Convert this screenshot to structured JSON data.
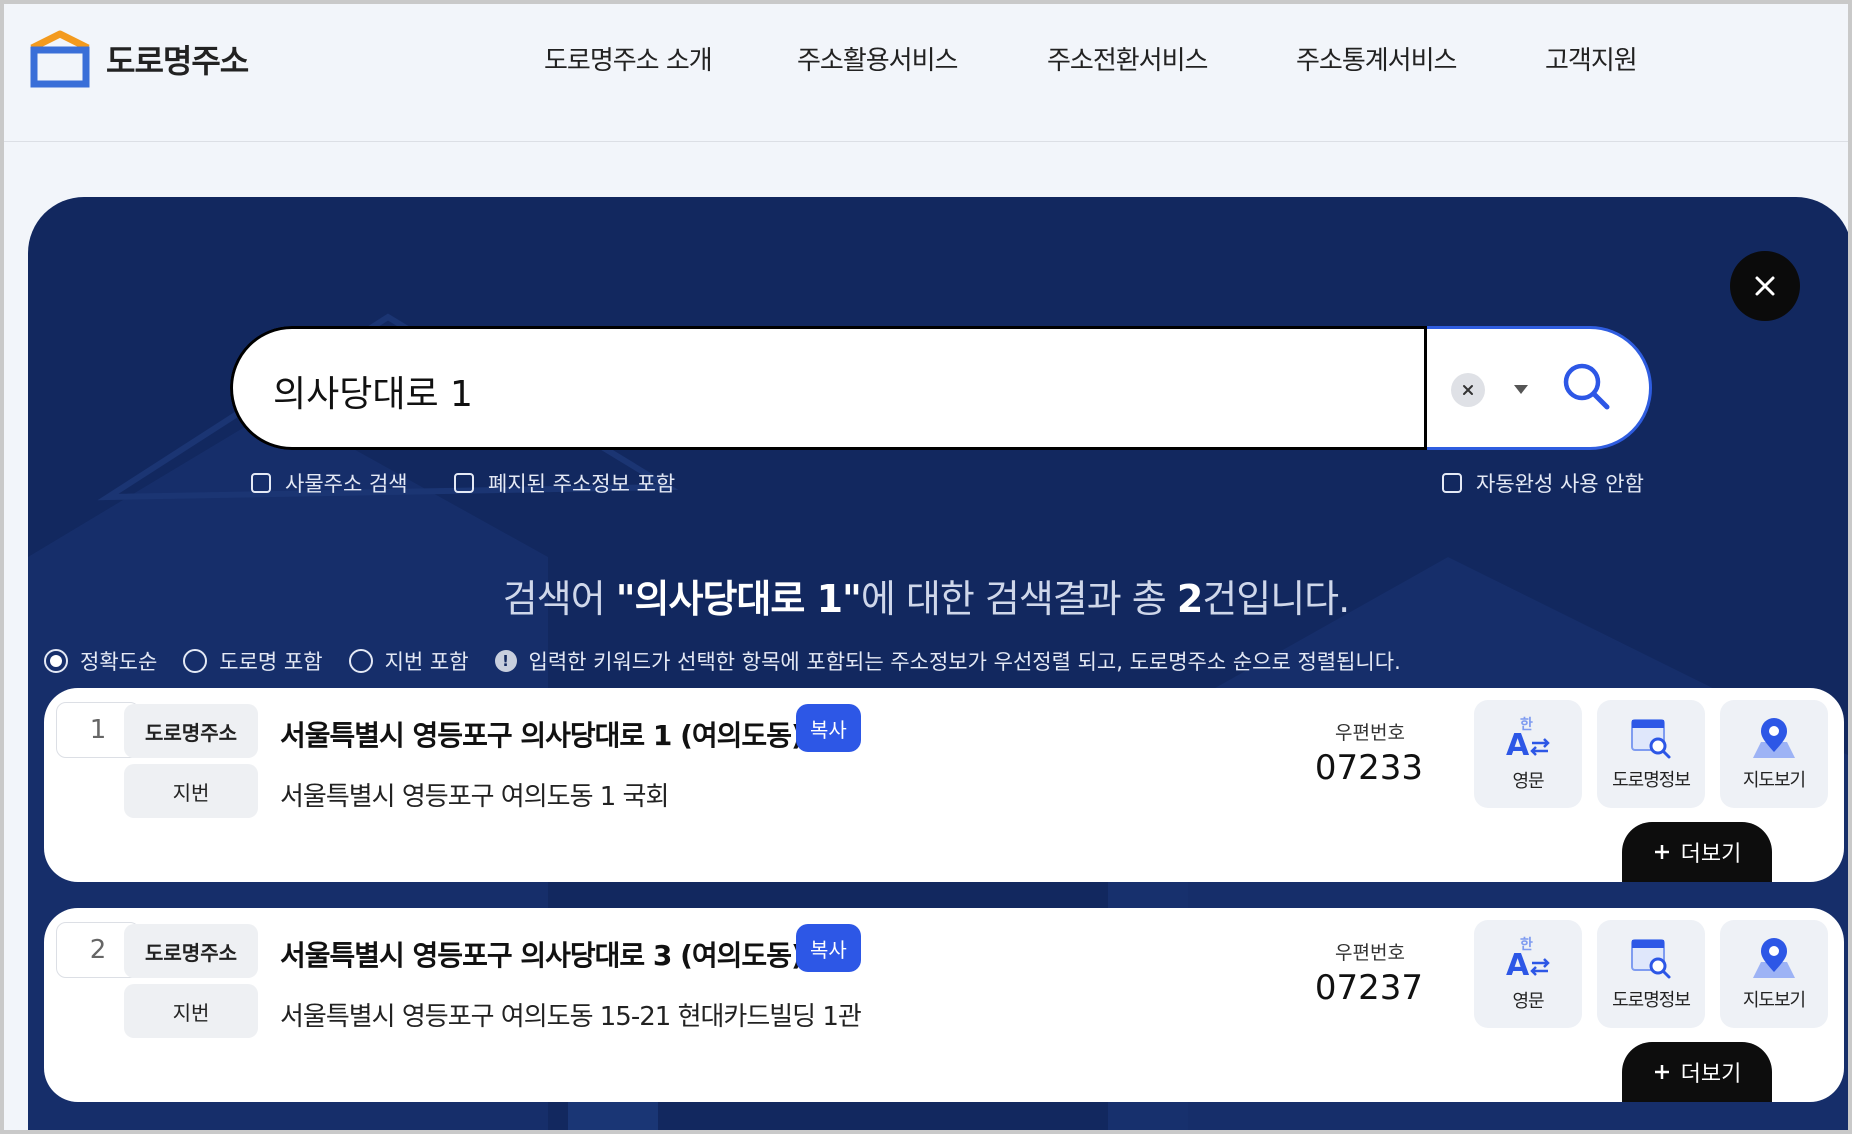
{
  "header": {
    "logo_text": "도로명주소",
    "nav": [
      "도로명주소 소개",
      "주소활용서비스",
      "주소전환서비스",
      "주소통계서비스",
      "고객지원"
    ]
  },
  "search": {
    "query": "의사당대로 1",
    "options": {
      "building_search": "사물주소 검색",
      "include_abolished": "폐지된 주소정보 포함",
      "no_autocomplete": "자동완성 사용 안함"
    }
  },
  "result_summary": {
    "prefix": "검색어 ",
    "keyword": "\"의사당대로 1\"",
    "middle": "에 대한 검색결과 총 ",
    "count": "2",
    "suffix": "건입니다."
  },
  "sort": {
    "options": [
      "정확도순",
      "도로명 포함",
      "지번 포함"
    ],
    "selected": "정확도순",
    "info": "입력한 키워드가 선택한 항목에 포함되는 주소정보가 우선정렬 되고, 도로명주소 순으로 정렬됩니다."
  },
  "labels": {
    "road_tag": "도로명주소",
    "jibun_tag": "지번",
    "copy": "복사",
    "zip": "우편번호",
    "english": "영문",
    "road_info": "도로명정보",
    "map": "지도보기",
    "more": "더보기"
  },
  "results": [
    {
      "num": "1",
      "road": "서울특별시 영등포구 의사당대로 1 (여의도동)",
      "jibun": "서울특별시 영등포구 여의도동 1 국회",
      "zip": "07233"
    },
    {
      "num": "2",
      "road": "서울특별시 영등포구 의사당대로 3 (여의도동)",
      "jibun": "서울특별시 영등포구 여의도동 15-21 현대카드빌딩 1관",
      "zip": "07237"
    }
  ],
  "colors": {
    "panel": "#12285f",
    "accent": "#2d57e6",
    "logo_orange": "#f39a1e",
    "logo_blue": "#3a6fd8"
  }
}
